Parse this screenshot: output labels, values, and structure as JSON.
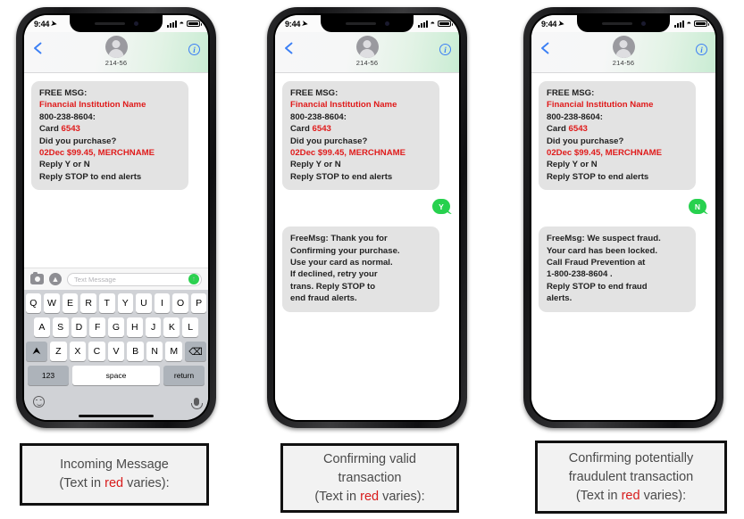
{
  "phones": [
    {
      "id": "phone-incoming",
      "status": {
        "time": "9:44",
        "location_icon": "location-arrow-icon",
        "signal_icon": "cellular-bars-icon",
        "wifi_icon": "wifi-icon",
        "battery_icon": "battery-icon"
      },
      "nav": {
        "back_icon": "back-chevron-icon",
        "avatar_icon": "contact-avatar-icon",
        "contact": "214-56",
        "info_icon": "info-circle-icon"
      },
      "messages": [
        {
          "type": "incoming",
          "lines": [
            {
              "parts": [
                {
                  "t": "FREE MSG:",
                  "c": "dark"
                }
              ]
            },
            {
              "parts": [
                {
                  "t": "Financial Institution Name",
                  "c": "red"
                }
              ]
            },
            {
              "parts": [
                {
                  "t": "800-238-8604:",
                  "c": "dark"
                }
              ]
            },
            {
              "parts": [
                {
                  "t": "Card ",
                  "c": "dark"
                },
                {
                  "t": "6543",
                  "c": "red"
                }
              ]
            },
            {
              "parts": [
                {
                  "t": "Did you purchase?",
                  "c": "dark"
                }
              ]
            },
            {
              "parts": [
                {
                  "t": "02Dec $99.45, MERCHNAME",
                  "c": "red"
                }
              ]
            },
            {
              "parts": [
                {
                  "t": "Reply Y or N",
                  "c": "dark"
                }
              ]
            },
            {
              "parts": [
                {
                  "t": "Reply STOP to end alerts",
                  "c": "dark"
                }
              ]
            }
          ]
        }
      ],
      "input": {
        "camera_icon": "camera-icon",
        "apps_icon": "app-store-icon",
        "placeholder": "Text Message",
        "send_icon": "send-arrow-icon"
      },
      "keyboard": {
        "row1": [
          "Q",
          "W",
          "E",
          "R",
          "T",
          "Y",
          "U",
          "I",
          "O",
          "P"
        ],
        "row2": [
          "A",
          "S",
          "D",
          "F",
          "G",
          "H",
          "J",
          "K",
          "L"
        ],
        "row3": [
          "Z",
          "X",
          "C",
          "V",
          "B",
          "N",
          "M"
        ],
        "shift_icon": "shift-arrow-icon",
        "backspace_icon": "backspace-icon",
        "numbers_key": "123",
        "space_key": "space",
        "return_key": "return",
        "emoji_icon": "emoji-face-icon",
        "mic_icon": "microphone-icon"
      },
      "show_keyboard": true
    },
    {
      "id": "phone-valid",
      "status": {
        "time": "9:44",
        "location_icon": "location-arrow-icon",
        "signal_icon": "cellular-bars-icon",
        "wifi_icon": "wifi-icon",
        "battery_icon": "battery-icon"
      },
      "nav": {
        "back_icon": "back-chevron-icon",
        "avatar_icon": "contact-avatar-icon",
        "contact": "214-56",
        "info_icon": "info-circle-icon"
      },
      "messages": [
        {
          "type": "incoming",
          "lines": [
            {
              "parts": [
                {
                  "t": "FREE MSG:",
                  "c": "dark"
                }
              ]
            },
            {
              "parts": [
                {
                  "t": "Financial Institution Name",
                  "c": "red"
                }
              ]
            },
            {
              "parts": [
                {
                  "t": "800-238-8604:",
                  "c": "dark"
                }
              ]
            },
            {
              "parts": [
                {
                  "t": "Card ",
                  "c": "dark"
                },
                {
                  "t": "6543",
                  "c": "red"
                }
              ]
            },
            {
              "parts": [
                {
                  "t": "Did you purchase?",
                  "c": "dark"
                }
              ]
            },
            {
              "parts": [
                {
                  "t": "02Dec $99.45, MERCHNAME",
                  "c": "red"
                }
              ]
            },
            {
              "parts": [
                {
                  "t": "Reply Y or N",
                  "c": "dark"
                }
              ]
            },
            {
              "parts": [
                {
                  "t": "Reply STOP to end alerts",
                  "c": "dark"
                }
              ]
            }
          ]
        },
        {
          "type": "outgoing",
          "text": "Y"
        },
        {
          "type": "incoming",
          "lines": [
            {
              "parts": [
                {
                  "t": "FreeMsg: Thank you for",
                  "c": "dark"
                }
              ]
            },
            {
              "parts": [
                {
                  "t": "Confirming your purchase.",
                  "c": "dark"
                }
              ]
            },
            {
              "parts": [
                {
                  "t": "Use your card as normal.",
                  "c": "dark"
                }
              ]
            },
            {
              "parts": [
                {
                  "t": "If declined, retry your",
                  "c": "dark"
                }
              ]
            },
            {
              "parts": [
                {
                  "t": "trans. Reply STOP to",
                  "c": "dark"
                }
              ]
            },
            {
              "parts": [
                {
                  "t": "end fraud alerts.",
                  "c": "dark"
                }
              ]
            }
          ]
        }
      ],
      "show_keyboard": false
    },
    {
      "id": "phone-fraud",
      "status": {
        "time": "9:44",
        "location_icon": "location-arrow-icon",
        "signal_icon": "cellular-bars-icon",
        "wifi_icon": "wifi-icon",
        "battery_icon": "battery-icon"
      },
      "nav": {
        "back_icon": "back-chevron-icon",
        "avatar_icon": "contact-avatar-icon",
        "contact": "214-56",
        "info_icon": "info-circle-icon"
      },
      "messages": [
        {
          "type": "incoming",
          "lines": [
            {
              "parts": [
                {
                  "t": "FREE MSG:",
                  "c": "dark"
                }
              ]
            },
            {
              "parts": [
                {
                  "t": "Financial Institution Name",
                  "c": "red"
                }
              ]
            },
            {
              "parts": [
                {
                  "t": "800-238-8604:",
                  "c": "dark"
                }
              ]
            },
            {
              "parts": [
                {
                  "t": "Card ",
                  "c": "dark"
                },
                {
                  "t": "6543",
                  "c": "red"
                }
              ]
            },
            {
              "parts": [
                {
                  "t": "Did you purchase?",
                  "c": "dark"
                }
              ]
            },
            {
              "parts": [
                {
                  "t": "02Dec $99.45, MERCHNAME",
                  "c": "red"
                }
              ]
            },
            {
              "parts": [
                {
                  "t": "Reply Y or N",
                  "c": "dark"
                }
              ]
            },
            {
              "parts": [
                {
                  "t": "Reply STOP to end alerts",
                  "c": "dark"
                }
              ]
            }
          ]
        },
        {
          "type": "outgoing",
          "text": "N"
        },
        {
          "type": "incoming",
          "lines": [
            {
              "parts": [
                {
                  "t": "FreeMsg: We suspect fraud.",
                  "c": "dark"
                }
              ]
            },
            {
              "parts": [
                {
                  "t": "Your card has been locked.",
                  "c": "dark"
                }
              ]
            },
            {
              "parts": [
                {
                  "t": "Call Fraud Prevention at",
                  "c": "dark"
                }
              ]
            },
            {
              "parts": [
                {
                  "t": "1-800-238-8604 .",
                  "c": "dark"
                }
              ]
            },
            {
              "parts": [
                {
                  "t": "Reply STOP to end fraud",
                  "c": "dark"
                }
              ]
            },
            {
              "parts": [
                {
                  "t": "alerts.",
                  "c": "dark"
                }
              ]
            }
          ]
        }
      ],
      "show_keyboard": false
    }
  ],
  "captions": [
    {
      "id": "caption-incoming",
      "lines": [
        {
          "parts": [
            {
              "t": "Incoming Message",
              "c": "gray"
            }
          ]
        },
        {
          "parts": [
            {
              "t": "(Text in ",
              "c": "gray"
            },
            {
              "t": "red",
              "c": "red"
            },
            {
              "t": " varies):",
              "c": "gray"
            }
          ]
        }
      ]
    },
    {
      "id": "caption-valid",
      "lines": [
        {
          "parts": [
            {
              "t": "Confirming valid",
              "c": "gray"
            }
          ]
        },
        {
          "parts": [
            {
              "t": "transaction",
              "c": "gray"
            }
          ]
        },
        {
          "parts": [
            {
              "t": "(Text in ",
              "c": "gray"
            },
            {
              "t": "red",
              "c": "red"
            },
            {
              "t": " varies):",
              "c": "gray"
            }
          ]
        }
      ]
    },
    {
      "id": "caption-fraud",
      "lines": [
        {
          "parts": [
            {
              "t": "Confirming potentially",
              "c": "gray"
            }
          ]
        },
        {
          "parts": [
            {
              "t": "fraudulent transaction",
              "c": "gray"
            }
          ]
        },
        {
          "parts": [
            {
              "t": "(Text in ",
              "c": "gray"
            },
            {
              "t": "red",
              "c": "red"
            },
            {
              "t": " varies):",
              "c": "gray"
            }
          ]
        }
      ]
    }
  ],
  "colors": {
    "red_accent": "#e01b1b",
    "incoming_bubble": "#e3e3e3",
    "outgoing_bubble": "#27d14e",
    "ios_blue": "#3b7ff5",
    "caption_bg": "#f2f2f2"
  }
}
